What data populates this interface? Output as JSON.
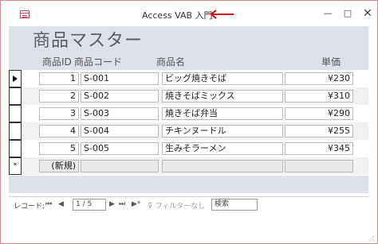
{
  "window": {
    "title": "Access VAB 入門",
    "minimize_label": "—",
    "maximize_label": "□",
    "close_label": "✕"
  },
  "form": {
    "header": "商品マスター",
    "columns": [
      "商品ID",
      "商品コード",
      "商品名",
      "単価"
    ],
    "rows": [
      {
        "id": "1",
        "code": "S-001",
        "name": "ビッグ焼きそば",
        "price": "¥230"
      },
      {
        "id": "2",
        "code": "S-002",
        "name": "焼きそばミックス",
        "price": "¥310"
      },
      {
        "id": "3",
        "code": "S-003",
        "name": "焼きそば弁当",
        "price": "¥290"
      },
      {
        "id": "4",
        "code": "S-004",
        "name": "チキンヌードル",
        "price": "¥255"
      },
      {
        "id": "5",
        "code": "S-005",
        "name": "生みそラーメン",
        "price": "¥345"
      }
    ],
    "new_row": {
      "selector": "*",
      "id": "(新規)"
    }
  },
  "navigation": {
    "record_label": "レコード:",
    "first": "⏮",
    "prev": "◀",
    "position": "1 / 5",
    "next": "▶",
    "last": "⏭",
    "new": "▶*",
    "filter_label": "フィルターなし",
    "search_placeholder": "検索"
  },
  "colors": {
    "arrow": "#d0021b",
    "form_background": "#dfe1ea",
    "window_border": "#d8868c"
  }
}
